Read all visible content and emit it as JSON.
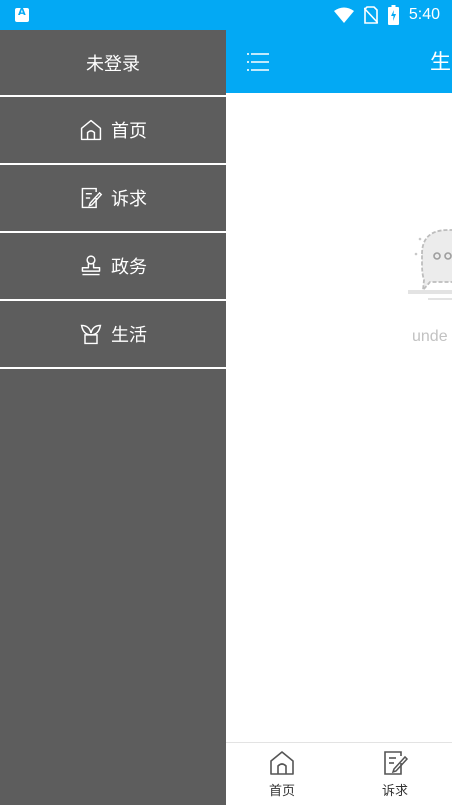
{
  "status_bar": {
    "time": "5:40",
    "app_icon": "A",
    "icons": [
      "wifi-icon",
      "no-sim-icon",
      "battery-charging-icon"
    ],
    "color": "#03a9f4"
  },
  "drawer": {
    "header": "未登录",
    "items": [
      {
        "label": "首页",
        "icon": "home-icon"
      },
      {
        "label": "诉求",
        "icon": "edit-note-icon"
      },
      {
        "label": "政务",
        "icon": "stamp-icon"
      },
      {
        "label": "生活",
        "icon": "sprout-icon"
      }
    ],
    "background": "#5d5d5d"
  },
  "page": {
    "title": "生",
    "empty_text": "unde",
    "empty_icon": "chat-bubble-icon",
    "accent": "#03a9f4"
  },
  "tabbar": {
    "tabs": [
      {
        "label": "首页",
        "icon": "home-icon"
      },
      {
        "label": "诉求",
        "icon": "edit-note-icon"
      }
    ]
  }
}
